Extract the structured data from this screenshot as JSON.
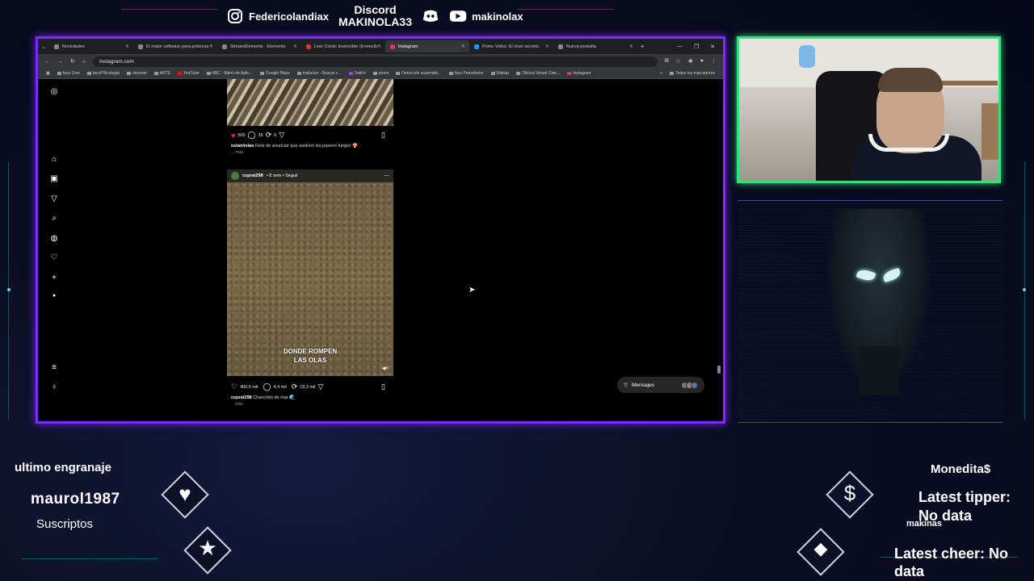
{
  "social": {
    "instagram_handle": "Federicolandiax",
    "discord_label": "Discord",
    "discord_name": "MAKINOLA33",
    "youtube_handle": "makinolax"
  },
  "browser": {
    "tabs": [
      {
        "label": "Novedades",
        "active": false
      },
      {
        "label": "El mejor software para potencia",
        "active": false
      },
      {
        "label": "StreamElements · Elements",
        "active": false
      },
      {
        "label": "Leer Comic Invencible (Invencib",
        "active": false
      },
      {
        "label": "Instagram",
        "active": true
      },
      {
        "label": "Prime Video: El nivel secreto",
        "active": false
      },
      {
        "label": "Nueva pestaña",
        "active": false
      }
    ],
    "url": "instagram.com",
    "bookmarks": [
      "facu Cine",
      "facuPSicologia",
      "docente",
      "ARTE",
      "YouTube",
      "ABC - Menú de Aplic...",
      "Google Maps",
      "traductor - Buscar c...",
      "Twitch",
      "strem",
      "Detección automátic...",
      "facu Periodismo",
      "Edelap",
      "Oficina Virtual Cam...",
      "Instagram"
    ],
    "bookmarks_all": "Todos los marcadores"
  },
  "feed": {
    "post1": {
      "likes": "565",
      "comments": "35",
      "reposts": "6",
      "author": "estaniislao",
      "caption": "Feliz de anunciar que vuelven los paseos fungis! 🍄",
      "more": "... más"
    },
    "post2": {
      "author": "csprat298",
      "meta": "• 8 sem • Seguir",
      "overlay_line1": "DONDE ROMPEN",
      "overlay_line2": "LAS OLAS",
      "likes": "406,5 mil",
      "comments": "4,4 mil",
      "reposts": "19,3 mil",
      "caption_author": "csprat298",
      "caption": "Chanchito de mar 🌊",
      "more": "más"
    },
    "messages_label": "Mensajes"
  },
  "widgets": {
    "last_gear_label": "ultimo engranaje",
    "last_gear_name": "maurol1987",
    "subs_label": "Suscriptos",
    "currency_label": "Monedita$",
    "latest_tipper_label": "Latest tipper:",
    "latest_tipper_value": "No data",
    "makinas_label": "makinas",
    "latest_cheer": "Latest cheer: No data"
  },
  "colors": {
    "browser_border": "#7d2cf0",
    "cam_border": "#37e07a",
    "accent_line": "#2a8a8f"
  },
  "icons": [
    "instagram-icon",
    "discord-icon",
    "youtube-icon",
    "heart-icon",
    "star-icon",
    "dollar-icon",
    "gem-icon"
  ]
}
